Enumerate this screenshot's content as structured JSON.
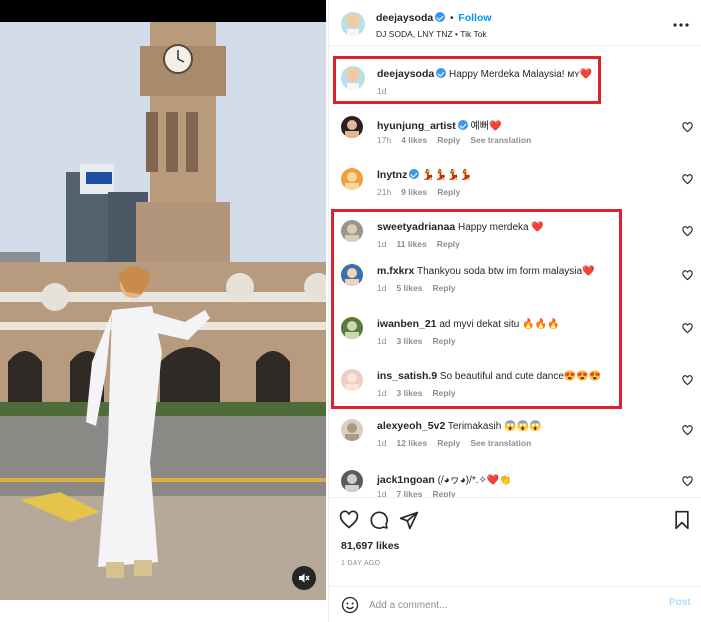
{
  "header": {
    "username": "deejaysoda",
    "separator": "•",
    "follow_label": "Follow",
    "subtitle": "DJ SODA, LNY TNZ • Tik Tok",
    "more_icon": "more-horizontal-icon"
  },
  "caption": {
    "username": "deejaysoda",
    "text": "Happy Merdeka Malaysia! ᴍʏ❤️",
    "time": "1d"
  },
  "comments": [
    {
      "username": "hyunjung_artist",
      "verified": true,
      "text": "예뻐❤️",
      "time": "17h",
      "likes": "4 likes",
      "reply": "Reply",
      "translation": "See translation"
    },
    {
      "username": "lnytnz",
      "verified": true,
      "text": "💃💃💃💃",
      "time": "21h",
      "likes": "9 likes",
      "reply": "Reply",
      "translation": ""
    },
    {
      "username": "sweetyadrianaa",
      "verified": false,
      "text": "Happy merdeka ❤️",
      "time": "1d",
      "likes": "11 likes",
      "reply": "Reply",
      "translation": ""
    },
    {
      "username": "m.fxkrx",
      "verified": false,
      "text": "Thankyou soda btw im form malaysia❤️",
      "time": "1d",
      "likes": "5 likes",
      "reply": "Reply",
      "translation": ""
    },
    {
      "username": "iwanben_21",
      "verified": false,
      "text": "ad myvi dekat situ 🔥🔥🔥",
      "time": "1d",
      "likes": "3 likes",
      "reply": "Reply",
      "translation": ""
    },
    {
      "username": "ins_satish.9",
      "verified": false,
      "text": "So beautiful and cute dance😍😍😍",
      "time": "1d",
      "likes": "3 likes",
      "reply": "Reply",
      "translation": ""
    },
    {
      "username": "alexyeoh_5v2",
      "verified": false,
      "text": "Terimakasih 😱😱😱",
      "time": "1d",
      "likes": "12 likes",
      "reply": "Reply",
      "translation": "See translation"
    },
    {
      "username": "jack1ngoan",
      "verified": false,
      "text": "(/◕ヮ◕)/*.✧❤️👏",
      "time": "1d",
      "likes": "7 likes",
      "reply": "Reply",
      "translation": ""
    }
  ],
  "actions": {
    "likes": "81,697 likes",
    "date": "1 DAY AGO"
  },
  "composer": {
    "placeholder": "Add a comment...",
    "post_label": "Post"
  },
  "colors": {
    "accent_blue": "#0095f6",
    "highlight_red": "#e0202b",
    "like_red": "#ed4956"
  }
}
